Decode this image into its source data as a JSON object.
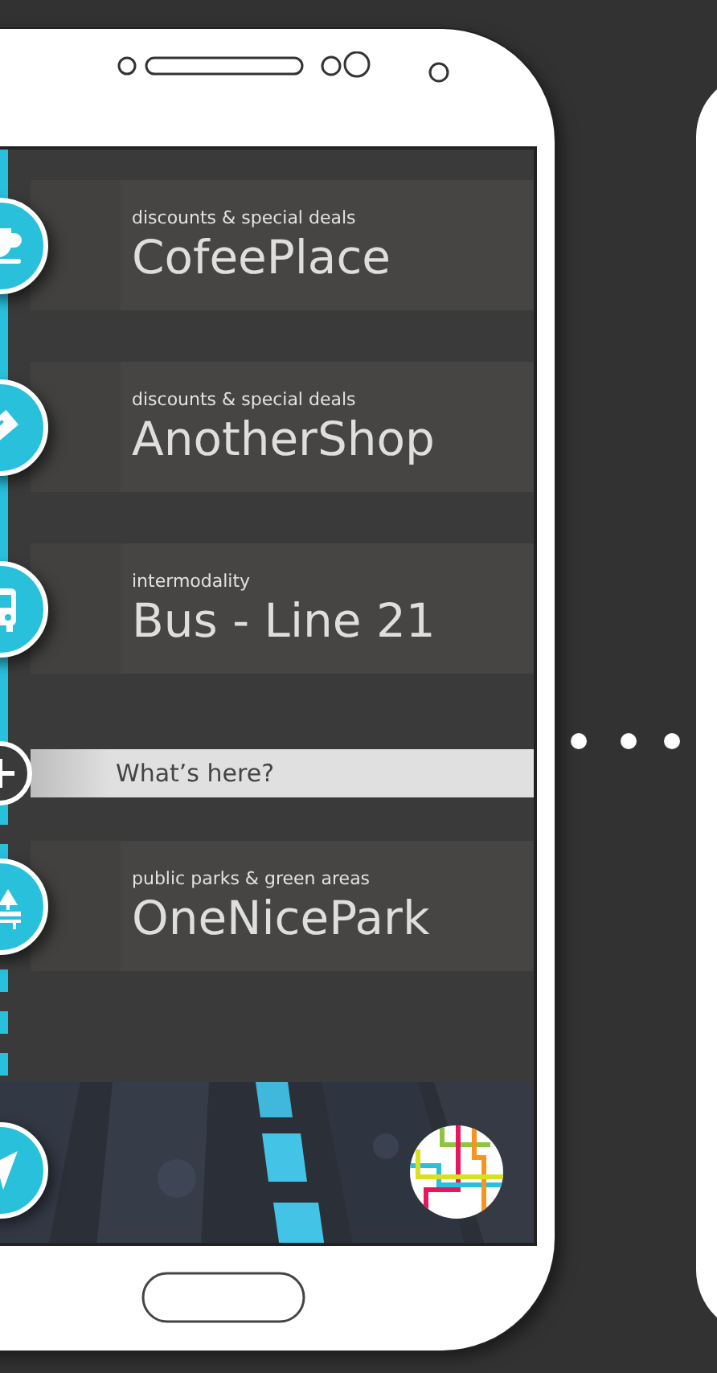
{
  "places": [
    {
      "kind": "place",
      "category": "discounts & special deals",
      "name": "CofeePlace"
    },
    {
      "kind": "place",
      "category": "discounts & special deals",
      "name": "AnotherShop"
    },
    {
      "kind": "place",
      "category": "intermodality",
      "name": "Bus - Line 21"
    },
    {
      "kind": "search",
      "placeholder": "What’s here?"
    },
    {
      "kind": "place",
      "category": "public parks & green areas",
      "name": "OneNicePark"
    }
  ]
}
